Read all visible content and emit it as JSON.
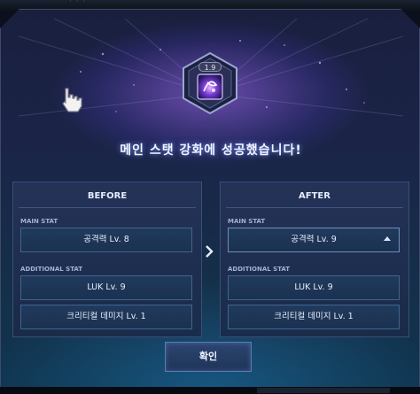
{
  "dialog": {
    "badge_level": "1.9",
    "success_message": "메인 스탯 강화에 성공했습니다!",
    "confirm_label": "확인"
  },
  "before": {
    "title": "BEFORE",
    "main_stat_label": "MAIN STAT",
    "main_stat_value": "공격력 Lv. 8",
    "additional_stat_label": "ADDITIONAL STAT",
    "additional_stats": [
      "LUK Lv. 9",
      "크리티컬 데미지 Lv. 1"
    ]
  },
  "after": {
    "title": "AFTER",
    "main_stat_label": "MAIN STAT",
    "main_stat_value": "공격력 Lv. 9",
    "additional_stat_label": "ADDITIONAL STAT",
    "additional_stats": [
      "LUK Lv. 9",
      "크리티컬 데미지 Lv. 1"
    ]
  },
  "icons": {
    "badge": "enhancement-crystal-icon",
    "next": "chevron-right-icon",
    "upgrade": "up-triangle-icon",
    "pointer": "hand-cursor-icon"
  },
  "colors": {
    "accent_glow": "#a070ff",
    "panel_border": "#3e6690",
    "text": "#e8efff"
  }
}
